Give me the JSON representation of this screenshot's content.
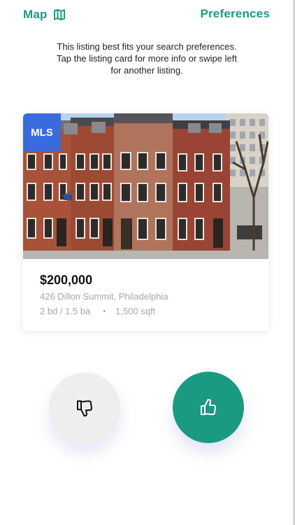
{
  "header": {
    "map_label": "Map",
    "map_icon": "map-icon",
    "preferences_label": "Preferences",
    "accent_color": "#1b9a82"
  },
  "intro": {
    "line1": "This listing best fits your search preferences.",
    "line2": "Tap the listing card for more info or swipe left",
    "line3": "for another listing."
  },
  "listing": {
    "badge": "MLS",
    "badge_color": "#3a6bdc",
    "price": "$200,000",
    "address": "426 Dillon Summit, Philadelphia",
    "beds_baths": "2 bd / 1.5 ba",
    "separator": "•",
    "sqft": "1,500 sqft",
    "photo": "row-of-brick-townhouses"
  },
  "actions": {
    "dislike_icon": "thumbs-down-icon",
    "like_icon": "thumbs-up-icon"
  }
}
